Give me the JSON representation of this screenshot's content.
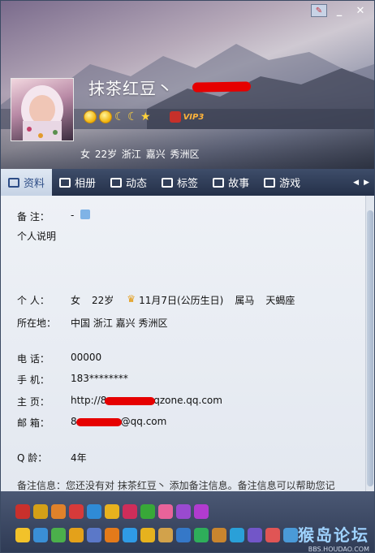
{
  "window": {
    "controls": [
      "?",
      "_",
      "✕"
    ]
  },
  "profile": {
    "name": "抹茶红豆丶",
    "vip": "VIP3",
    "basic_info": "女   22岁   浙江 嘉兴 秀洲区"
  },
  "tabs": [
    {
      "label": "资料",
      "icon": "profile-card-icon"
    },
    {
      "label": "相册",
      "icon": "photo-album-icon"
    },
    {
      "label": "动态",
      "icon": "feed-icon"
    },
    {
      "label": "标签",
      "icon": "tag-icon"
    },
    {
      "label": "故事",
      "icon": "story-icon"
    },
    {
      "label": "游戏",
      "icon": "game-icon"
    }
  ],
  "details": {
    "remark_label": "备   注：",
    "remark_value": "-",
    "personal_desc_label": "个人说明",
    "person_label": "个   人：",
    "gender": "女",
    "age": "22岁",
    "birthday": "11月7日(公历生日)",
    "zodiac": "属马",
    "constellation": "天蝎座",
    "location_label": "所在地：",
    "location": "中国 浙江 嘉兴 秀洲区",
    "phone_label": "电   话：",
    "phone": "00000",
    "mobile_label": "手   机：",
    "mobile": "183********",
    "homepage_label": "主   页：",
    "homepage_prefix": "http://8",
    "homepage_suffix": ".qzone.qq.com",
    "email_label": "邮   箱：",
    "email_prefix": "8",
    "email_suffix": "@qq.com",
    "qage_label": "Q   龄：",
    "qage": "4年",
    "note": "备注信息：您还没有对 抹茶红豆丶 添加备注信息。备注信息可以帮助您记"
  },
  "watermark": {
    "title": "猴岛论坛",
    "url": "BBS.HOUDAO.COM"
  },
  "colors": {
    "accent": "#2d4d86",
    "header_dark": "#243049",
    "redact": "#e60000"
  }
}
